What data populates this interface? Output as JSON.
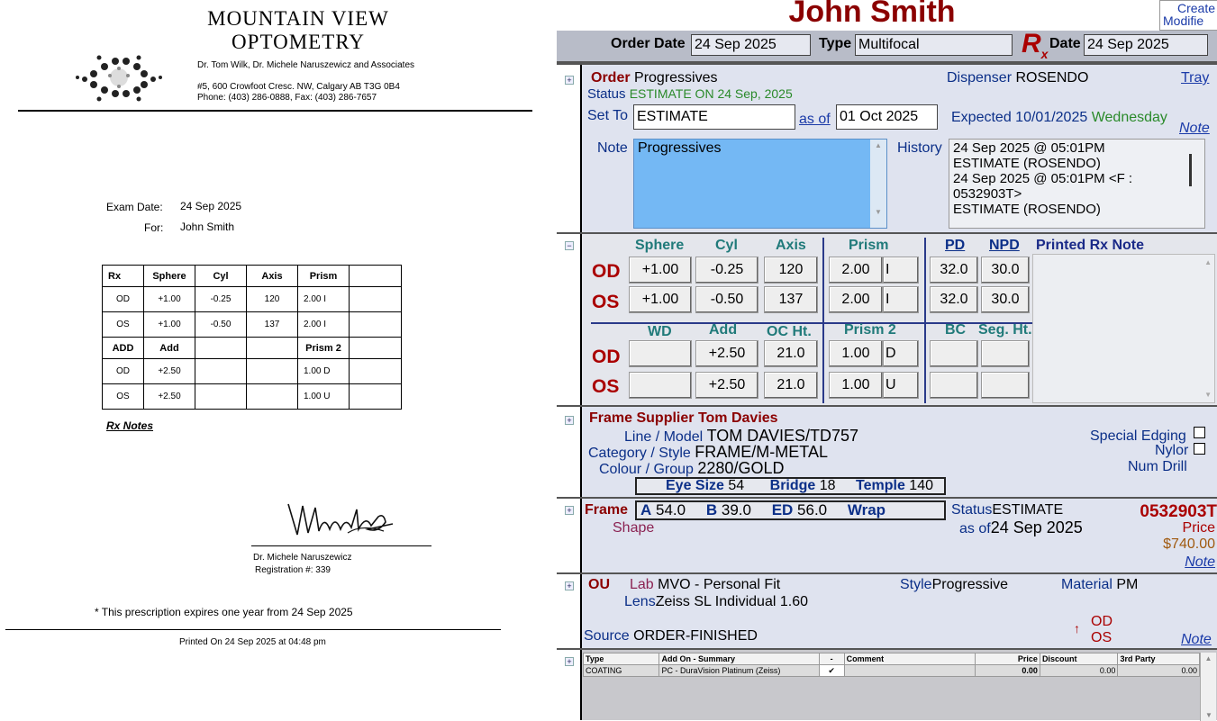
{
  "doc": {
    "clinic_line1": "MOUNTAIN VIEW",
    "clinic_line2": "OPTOMETRY",
    "doctors": "Dr. Tom Wilk, Dr. Michele Naruszewicz and Associates",
    "address": "#5, 600 Crowfoot Cresc. NW, Calgary AB T3G 0B4",
    "phone": "Phone: (403) 286-0888, Fax: (403) 286-7657",
    "exam_date_label": "Exam Date:",
    "exam_date": "24 Sep 2025",
    "for_label": "For:",
    "for_name": "John Smith",
    "table": {
      "headers": [
        "Rx",
        "Sphere",
        "Cyl",
        "Axis",
        "Prism",
        ""
      ],
      "rows": [
        [
          "OD",
          "+1.00",
          "-0.25",
          "120",
          "2.00  I",
          ""
        ],
        [
          "OS",
          "+1.00",
          "-0.50",
          "137",
          "2.00  I",
          ""
        ]
      ],
      "headers2": [
        "ADD",
        "Add",
        "",
        "",
        "Prism 2",
        ""
      ],
      "rows2": [
        [
          "OD",
          "+2.50",
          "",
          "",
          "1.00  D",
          ""
        ],
        [
          "OS",
          "+2.50",
          "",
          "",
          "1.00  U",
          ""
        ]
      ]
    },
    "rx_notes": "Rx Notes",
    "doctor_name": "Dr. Michele Naruszewicz",
    "registration": "Registration #: 339",
    "expiry": "* This prescription expires one year from 24 Sep 2025",
    "printed": "Printed On 24 Sep 2025 at 04:48 pm"
  },
  "app": {
    "patient_name": "John Smith",
    "create_label": "Create",
    "modified_label": "Modifie",
    "order_date_label": "Order Date",
    "order_date": "24 Sep 2025",
    "type_label": "Type",
    "type_value": "Multifocal",
    "rx_symbol": "R",
    "rx_sub": "x",
    "rx_date_label": "Date",
    "rx_date": "24 Sep 2025",
    "order": {
      "order_label": "Order",
      "order_value": "Progressives",
      "dispenser_label": "Dispenser",
      "dispenser_value": "ROSENDO",
      "tray_link": "Tray",
      "status_label": "Status",
      "status_value": "ESTIMATE ON 24 Sep, 2025",
      "set_to_label": "Set To",
      "set_to_value": "ESTIMATE",
      "as_of_link": "as of",
      "as_of_value": "01 Oct 2025",
      "expected_label": "Expected",
      "expected_value": "10/01/2025",
      "expected_day": "Wednesday",
      "note_link": "Note",
      "note_label": "Note",
      "note_value": "Progressives",
      "history_label": "History",
      "history_lines": [
        "24 Sep 2025 @ 05:01PM",
        "ESTIMATE (ROSENDO)",
        "24 Sep 2025 @ 05:01PM <F :",
        "0532903T>",
        "ESTIMATE (ROSENDO)"
      ]
    },
    "rx": {
      "headers": {
        "sphere": "Sphere",
        "cyl": "Cyl",
        "axis": "Axis",
        "prism": "Prism",
        "pd": "PD",
        "npd": "NPD",
        "printed_note": "Printed Rx Note"
      },
      "od_label": "OD",
      "os_label": "OS",
      "od": {
        "sphere": "+1.00",
        "cyl": "-0.25",
        "axis": "120",
        "prism": "2.00",
        "prism_dir": "I",
        "pd": "32.0",
        "npd": "30.0"
      },
      "os": {
        "sphere": "+1.00",
        "cyl": "-0.50",
        "axis": "137",
        "prism": "2.00",
        "prism_dir": "I",
        "pd": "32.0",
        "npd": "30.0"
      },
      "headers2": {
        "wd": "WD",
        "add": "Add",
        "oc": "OC Ht.",
        "prism2": "Prism 2",
        "bc": "BC",
        "seg": "Seg. Ht."
      },
      "od2": {
        "wd": "",
        "add": "+2.50",
        "oc": "21.0",
        "prism2": "1.00",
        "prism2_dir": "D",
        "bc": "",
        "seg": ""
      },
      "os2": {
        "wd": "",
        "add": "+2.50",
        "oc": "21.0",
        "prism2": "1.00",
        "prism2_dir": "U",
        "bc": "",
        "seg": ""
      }
    },
    "frame": {
      "supplier_label": "Frame Supplier",
      "supplier_value": "Tom Davies",
      "line_label": "Line / Model",
      "line_value": "TOM DAVIES",
      "model_value": "TD757",
      "category_label": "Category / Style",
      "category_value": "FRAME",
      "style_value": "M-METAL",
      "colour_label": "Colour / Group",
      "colour_value": "2280",
      "group_value": "GOLD",
      "eye_label": "Eye Size",
      "eye_value": "54",
      "bridge_label": "Bridge",
      "bridge_value": "18",
      "temple_label": "Temple",
      "temple_value": "140",
      "special_edging": "Special Edging",
      "nylon": "Nylor",
      "num_drill": "Num Drill"
    },
    "frame2": {
      "frame_label": "Frame",
      "a_label": "A",
      "a_value": "54.0",
      "b_label": "B",
      "b_value": "39.0",
      "ed_label": "ED",
      "ed_value": "56.0",
      "wrap_label": "Wrap",
      "shape_label": "Shape",
      "status_label": "Status",
      "status_value": "ESTIMATE",
      "as_of_label": "as of",
      "as_of_value": "24 Sep 2025",
      "order_no": "0532903T",
      "price_label": "Price",
      "price_value": "$740.00",
      "note_link": "Note"
    },
    "lens": {
      "ou_label": "OU",
      "lab_label": "Lab",
      "lab_value": "MVO - Personal Fit",
      "style_label": "Style",
      "style_value": "Progressive",
      "material_label": "Material",
      "material_value": "PM",
      "lens_label": "Lens",
      "lens_value": "Zeiss SL Individual 1.60",
      "od_label": "OD",
      "os_label": "OS",
      "source_label": "Source",
      "source_value": "ORDER-FINISHED",
      "note_link": "Note"
    },
    "addons": {
      "headers": [
        "Type",
        "Add On - Summary",
        "-",
        "Comment",
        "Price",
        "Discount",
        "3rd Party"
      ],
      "rows": [
        [
          "COATING",
          "PC - DuraVision Platinum (Zeiss)",
          "✔",
          "",
          "0.00",
          "0.00",
          "0.00"
        ]
      ]
    }
  }
}
